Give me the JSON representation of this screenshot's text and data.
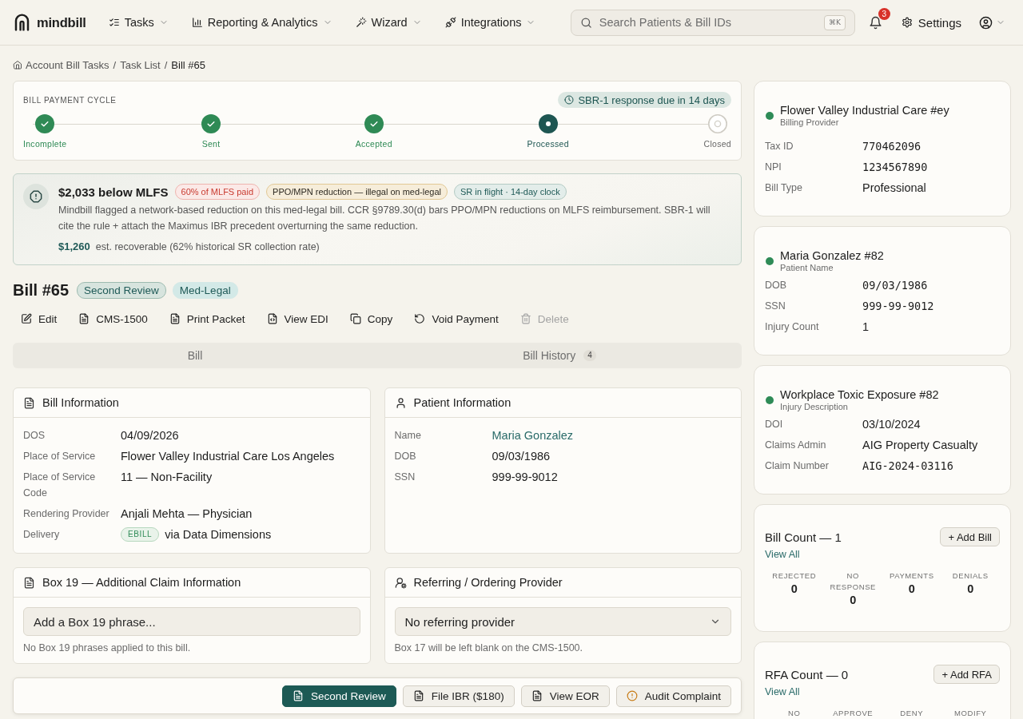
{
  "nav": {
    "logo": "mindbill",
    "menus": [
      {
        "label": "Tasks"
      },
      {
        "label": "Reporting & Analytics"
      },
      {
        "label": "Wizard"
      },
      {
        "label": "Integrations"
      }
    ],
    "search": {
      "placeholder": "Search Patients & Bill IDs",
      "shortcut": "⌘K"
    },
    "notification_count": "3",
    "settings": "Settings"
  },
  "breadcrumb": {
    "separator": "/",
    "items": [
      {
        "label": "Account Bill Tasks",
        "current": false
      },
      {
        "label": "Task List",
        "current": false
      },
      {
        "label": "Bill #65",
        "current": true
      }
    ]
  },
  "payment_cycle": {
    "title": "BILL PAYMENT CYCLE",
    "due": "SBR-1 response due in 14 days",
    "steps": [
      {
        "label": "Incomplete",
        "completed": true,
        "current": false
      },
      {
        "label": "Sent",
        "completed": true,
        "current": false
      },
      {
        "label": "Accepted",
        "completed": true,
        "current": false
      },
      {
        "label": "Processed",
        "completed": false,
        "current": true
      },
      {
        "label": "Closed",
        "completed": false,
        "current": false
      }
    ]
  },
  "alert": {
    "title": "$2,033 below MLFS",
    "tags": [
      {
        "label": "60% of MLFS paid",
        "kind": "danger"
      },
      {
        "label": "PPO/MPN reduction — illegal on med-legal",
        "kind": "warning"
      },
      {
        "label": "SR in flight · 14-day clock",
        "kind": "info"
      }
    ],
    "message": "Mindbill flagged a network-based reduction on this med-legal bill. CCR §9789.30(d) bars PPO/MPN reductions on MLFS reimbursement. SBR-1 will cite the rule + attach the Maximus IBR precedent overturning the same reduction.",
    "amount": "$1,260",
    "amount_note": "est. recoverable (62% historical SR collection rate)"
  },
  "bill": {
    "title": "Bill #65",
    "tags": [
      {
        "label": "Second Review",
        "kind": "review"
      },
      {
        "label": "Med-Legal",
        "kind": "accent"
      }
    ]
  },
  "actions": [
    {
      "label": "Edit",
      "disabled": false
    },
    {
      "label": "CMS-1500",
      "disabled": false
    },
    {
      "label": "Print Packet",
      "disabled": false
    },
    {
      "label": "View EDI",
      "disabled": false
    },
    {
      "label": "Copy",
      "disabled": false
    },
    {
      "label": "Void Payment",
      "disabled": false
    },
    {
      "label": "Delete",
      "disabled": true
    }
  ],
  "tabs": [
    {
      "label": "Bill",
      "selected": false
    },
    {
      "label": "Bill History",
      "count": "4",
      "selected": false
    }
  ],
  "info_cards": [
    {
      "title": "Bill Information",
      "rows": [
        {
          "label": "DOS",
          "value": "04/09/2026",
          "kind": "text"
        },
        {
          "label": "Place of Service",
          "value": "Flower Valley Industrial Care Los Angeles",
          "kind": "text"
        },
        {
          "label": "Place of Service Code",
          "value": "11 — Non-Facility",
          "kind": "text"
        },
        {
          "label": "Rendering Provider",
          "value": "Anjali Mehta — Physician",
          "kind": "text"
        },
        {
          "label": "Delivery",
          "badge": "EBILL",
          "value": "via Data Dimensions",
          "kind": "delivery"
        }
      ]
    },
    {
      "title": "Patient Information",
      "rows": [
        {
          "label": "Name",
          "value": "Maria Gonzalez",
          "kind": "link"
        },
        {
          "label": "DOB",
          "value": "09/03/1986",
          "kind": "text"
        },
        {
          "label": "SSN",
          "value": "999-99-9012",
          "kind": "text"
        }
      ]
    }
  ],
  "box_19": {
    "title": "Box 19 — Additional Claim Information",
    "placeholder": "Add a Box 19 phrase...",
    "hint": "No Box 19 phrases applied to this bill."
  },
  "referring_provider": {
    "title": "Referring / Ordering Provider",
    "value": "No referring provider",
    "hint": "Box 17 will be left blank on the CMS-1500."
  },
  "action_bar": [
    {
      "label": "Second Review",
      "kind": "primary"
    },
    {
      "label": "File IBR ($180)",
      "kind": "secondary"
    },
    {
      "label": "View EOR",
      "kind": "secondary"
    },
    {
      "label": "Audit Complaint",
      "kind": "secondary"
    }
  ],
  "entity_cards": [
    {
      "title": "Flower Valley Industrial Care #ey",
      "subtitle": "Billing Provider",
      "active": true,
      "rows": [
        {
          "label": "Tax ID",
          "value": "770462096",
          "kind": "mono"
        },
        {
          "label": "NPI",
          "value": "1234567890",
          "kind": "mono"
        },
        {
          "label": "Bill Type",
          "value": "Professional",
          "kind": "text"
        }
      ]
    },
    {
      "title": "Maria Gonzalez #82",
      "subtitle": "Patient Name",
      "active": true,
      "rows": [
        {
          "label": "DOB",
          "value": "09/03/1986",
          "kind": "mono"
        },
        {
          "label": "SSN",
          "value": "999-99-9012",
          "kind": "mono"
        },
        {
          "label": "Injury Count",
          "value": "1",
          "kind": "text"
        }
      ]
    },
    {
      "title": "Workplace Toxic Exposure #82",
      "subtitle": "Injury Description",
      "active": true,
      "rows": [
        {
          "label": "DOI",
          "value": "03/10/2024",
          "kind": "text"
        },
        {
          "label": "Claims Admin",
          "value": "AIG Property Casualty",
          "kind": "text"
        },
        {
          "label": "Claim Number",
          "value": "AIG-2024-03116",
          "kind": "mono"
        }
      ]
    }
  ],
  "count_cards": [
    {
      "title": "Bill Count — 1",
      "button": "+ Add Bill",
      "link": "View All",
      "stats": [
        {
          "label": "REJECTED",
          "value": "0"
        },
        {
          "label": "NO RESPONSE",
          "value": "0"
        },
        {
          "label": "PAYMENTS",
          "value": "0"
        },
        {
          "label": "DENIALS",
          "value": "0"
        }
      ]
    },
    {
      "title": "RFA Count — 0",
      "button": "+ Add RFA",
      "link": "View All",
      "stats": [
        {
          "label": "NO"
        },
        {
          "label": "APPROVE"
        },
        {
          "label": "DENY"
        },
        {
          "label": "MODIFY"
        }
      ]
    }
  ]
}
